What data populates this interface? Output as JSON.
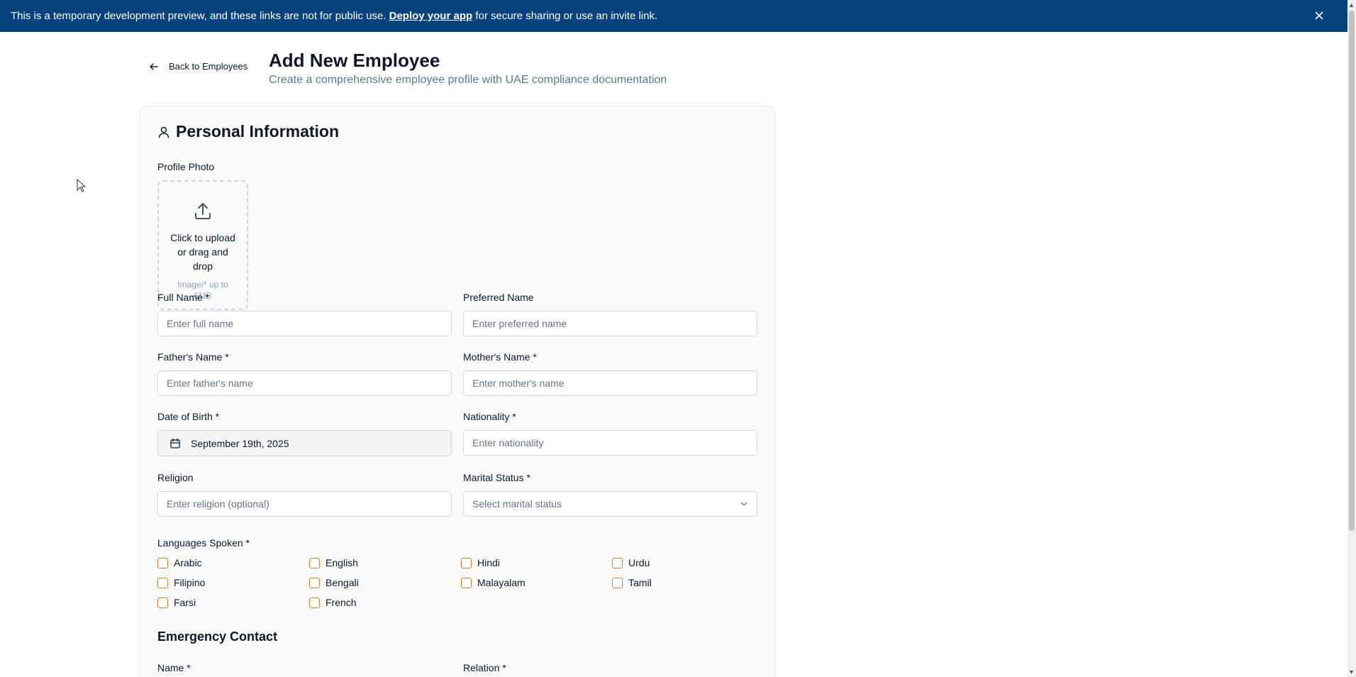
{
  "banner": {
    "text_before": "This is a temporary development preview, and these links are not for public use.",
    "link": "Deploy your app",
    "text_after": "for secure sharing or use an invite link.",
    "close_icon": "close-icon",
    "bg_color": "#05427f"
  },
  "header": {
    "back_label": "Back to Employees",
    "title": "Add New Employee",
    "subtitle": "Create a comprehensive employee profile with UAE compliance documentation"
  },
  "personal": {
    "section_title": "Personal Information",
    "section_icon": "user-icon",
    "profile_photo": {
      "label": "Profile Photo",
      "upload_text": "Click to upload or drag and drop",
      "upload_hint": "Image/* up to 5MB",
      "icon": "upload-icon"
    },
    "full_name": {
      "label": "Full Name *",
      "placeholder": "Enter full name",
      "value": ""
    },
    "preferred_name": {
      "label": "Preferred Name",
      "placeholder": "Enter preferred name",
      "value": ""
    },
    "father_name": {
      "label": "Father's Name *",
      "placeholder": "Enter father's name",
      "value": ""
    },
    "mother_name": {
      "label": "Mother's Name *",
      "placeholder": "Enter mother's name",
      "value": ""
    },
    "dob": {
      "label": "Date of Birth *",
      "value": "September 19th, 2025",
      "icon": "calendar-icon"
    },
    "nationality": {
      "label": "Nationality *",
      "placeholder": "Enter nationality",
      "value": ""
    },
    "religion": {
      "label": "Religion",
      "placeholder": "Enter religion (optional)",
      "value": ""
    },
    "marital_status": {
      "label": "Marital Status *",
      "placeholder": "Select marital status",
      "icon": "chevron-down-icon"
    },
    "languages": {
      "label": "Languages Spoken *",
      "options": [
        {
          "label": "Arabic",
          "checked": false
        },
        {
          "label": "English",
          "checked": false
        },
        {
          "label": "Hindi",
          "checked": false
        },
        {
          "label": "Urdu",
          "checked": false
        },
        {
          "label": "Filipino",
          "checked": false
        },
        {
          "label": "Bengali",
          "checked": false
        },
        {
          "label": "Malayalam",
          "checked": false
        },
        {
          "label": "Tamil",
          "checked": false
        },
        {
          "label": "Farsi",
          "checked": false
        },
        {
          "label": "French",
          "checked": false
        }
      ]
    }
  },
  "emergency": {
    "title": "Emergency Contact",
    "name_label": "Name *",
    "relation_label": "Relation *"
  },
  "colors": {
    "accent_checkbox": "#e07a2e",
    "text_primary": "#0f172a",
    "text_muted": "#64748b"
  }
}
